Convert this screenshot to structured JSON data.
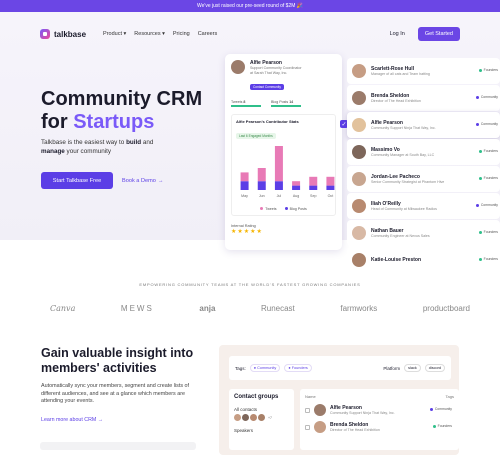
{
  "banner": {
    "text": "We've just raised our pre-seed round of $2M 🎉"
  },
  "nav": {
    "brand": "talkbase",
    "items": [
      "Product",
      "Resources",
      "Pricing",
      "Careers"
    ],
    "login": "Log In",
    "cta": "Get Started"
  },
  "hero": {
    "title_line1": "Community CRM",
    "title_line2_prefix": "for ",
    "title_line2_accent": "Startups",
    "subtitle_prefix": "Talkbase is the easiest way to ",
    "subtitle_b1": "build",
    "subtitle_mid": " and ",
    "subtitle_b2": "manage",
    "subtitle_suffix": " your community",
    "primary_button": "Start Talkbase Free",
    "demo_link": "Book a Demo"
  },
  "dashboard": {
    "name": "Alfie Pearson",
    "role_line1": "Support Community Coordinator",
    "role_line2": "at Sarah That Way, Inc.",
    "pill": "Contact Community",
    "stat1_label": "Tweets",
    "stat1_value": "8",
    "stat2_label": "Blog Posts",
    "stat2_value": "14",
    "chart_title": "Alfie Pearson's Contributor Stats",
    "chart_tag": "Last 6 Engaged Months",
    "rating_label": "Internal Rating",
    "stars": "★★★★★"
  },
  "chart_data": {
    "type": "bar",
    "categories": [
      "May",
      "Jun",
      "Jul",
      "Aug",
      "Sep",
      "Oct"
    ],
    "series": [
      {
        "name": "Tweets",
        "values": [
          2,
          3,
          8,
          1,
          2,
          2
        ]
      },
      {
        "name": "Blog Posts",
        "values": [
          2,
          2,
          2,
          1,
          1,
          1
        ]
      }
    ],
    "colors": {
      "Tweets": "#e87ab6",
      "Blog Posts": "#5b3ee6"
    }
  },
  "members": [
    {
      "name": "Scarlett-Rose Hull",
      "sub": "Manager of all cats and Team hatting",
      "tag": "Founders",
      "tag_color": "#2fbf8a"
    },
    {
      "name": "Brenda Sheldon",
      "sub": "Director of The Head Exhibition",
      "tag": "Community",
      "tag_color": "#5b3ee6"
    },
    {
      "name": "Alfie Pearson",
      "sub": "Community Support Ninja That Way, Inc.",
      "tag": "Community",
      "tag_color": "#5b3ee6"
    },
    {
      "name": "Massimo Vo",
      "sub": "Community Manager at South Bay, LLC",
      "tag": "Founders",
      "tag_color": "#2fbf8a"
    },
    {
      "name": "Jordan-Lee Pacheco",
      "sub": "Senior Community Strategist at Phantom Hive",
      "tag": "Founders",
      "tag_color": "#2fbf8a"
    },
    {
      "name": "Iliah O'Reilly",
      "sub": "Head of Community at Milwaukee Radios",
      "tag": "Community",
      "tag_color": "#5b3ee6"
    },
    {
      "name": "Nathan Bauer",
      "sub": "Community Engineer at Nexus Sales",
      "tag": "Founders",
      "tag_color": "#2fbf8a"
    },
    {
      "name": "Katie-Louise Preston",
      "sub": "",
      "tag": "Founders",
      "tag_color": "#2fbf8a"
    }
  ],
  "trust": {
    "label": "EMPOWERING COMMUNITY TEAMS AT THE WORLD'S FASTEST GROWING COMPANIES",
    "logos": [
      "Canva",
      "MEWS",
      "anja",
      "Runecast",
      "farmworks",
      "productboard"
    ]
  },
  "insight": {
    "title": "Gain valuable insight into members' activities",
    "subtitle": "Automatically sync your members, segment and create lists of different audiences, and see at a glance which members are attending your events.",
    "link": "Learn more about CRM"
  },
  "crm": {
    "tags_label": "Tags:",
    "chips": [
      "Community",
      "Founders"
    ],
    "platforms_label": "Platform",
    "platforms": [
      "slack",
      "discord"
    ],
    "groups_title": "Contact groups",
    "group1": "All contacts",
    "group1_more": "+7",
    "group2": "Speakers",
    "th_name": "Name",
    "th_tags": "Tags",
    "rows": [
      {
        "name": "Alfie Pearson",
        "sub": "Community Support Ninja That Way, Inc.",
        "tag": "Community"
      },
      {
        "name": "Brenda Sheldon",
        "sub": "Director of The Head Exhibition",
        "tag": "Founders"
      }
    ]
  }
}
